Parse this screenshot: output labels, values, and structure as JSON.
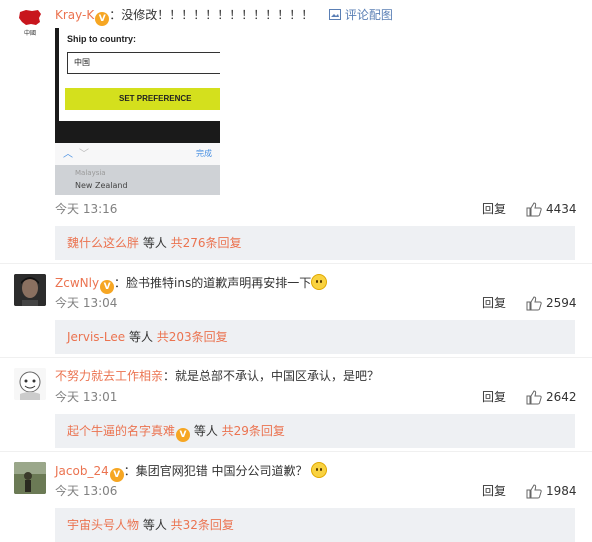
{
  "comments": [
    {
      "user": "Kray-K",
      "text": "：没修改！！！！！！！！！！！！！",
      "view_pic": "评论配图",
      "time": "今天 13:16",
      "reply": "回复",
      "likes": "4434",
      "sub": {
        "users": "魏什么这么胖",
        "mid": " 等人 ",
        "total": "共276条回复"
      }
    },
    {
      "user": "ZcwNly",
      "text": "：脸书推特ins的道歉声明再安排一下",
      "time": "今天 13:04",
      "reply": "回复",
      "likes": "2594",
      "sub": {
        "users": "Jervis-Lee",
        "mid": " 等人 ",
        "total": "共203条回复"
      }
    },
    {
      "user": "不努力就去工作相亲",
      "text": "：就是总部不承认，中国区承认，是吧？",
      "time": "今天 13:01",
      "reply": "回复",
      "likes": "2642",
      "sub": {
        "users": "起个牛逼的名字真难",
        "mid": " 等人 ",
        "total": "共29条回复"
      }
    },
    {
      "user": "Jacob_24",
      "text": "：集团官网犯错  中国分公司道歉？",
      "time": "今天 13:06",
      "reply": "回复",
      "likes": "1984",
      "sub": {
        "users": "宇宙头号人物",
        "mid": " 等人 ",
        "total": "共32条回复"
      }
    }
  ],
  "screenshot": {
    "ship_label": "Ship to country:",
    "country_value": "中国",
    "button_label": "SET PREFERENCE",
    "done_label": "完成",
    "picker_option_1": "Malaysia",
    "picker_option_2": "New Zealand"
  },
  "avatar_0_caption": "中國",
  "colors": {
    "accent": "#eb7350",
    "set_pref_button": "#d4e01d",
    "link_blue": "#5a7fb5"
  }
}
